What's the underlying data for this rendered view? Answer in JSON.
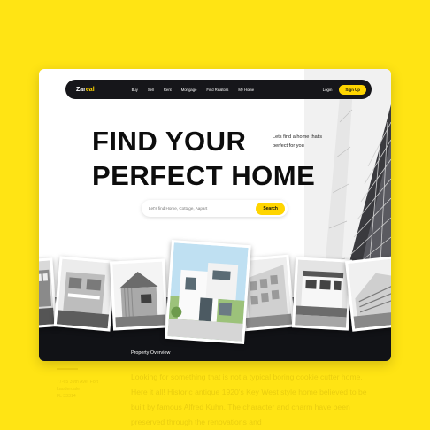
{
  "nav": {
    "logo_main": "Zar",
    "logo_accent": "eal",
    "menu": [
      "Buy",
      "Sell",
      "Rent",
      "Mortgage",
      "Find Realtors",
      "My Home"
    ],
    "login": "Login",
    "signup": "Sign Up"
  },
  "hero": {
    "title_line1": "FIND YOUR",
    "title_line2": "PERFECT HOME",
    "tagline": "Lets find a home that's perfect for you"
  },
  "search": {
    "placeholder": "Let's find Home, Cottage, Aapart",
    "button": "Search"
  },
  "section": {
    "overview_label": "Property Overview"
  },
  "reflection": {
    "address": [
      "77-65 39th Ave, Fort",
      "Lauderdale",
      "FL 33314"
    ],
    "paragraph": "Looking for something that is not a typical boring cookie cutter home. Here it all! Historic antique 1920's Key West style home believed to be built by famous Alfred Kuhn. The character and charm have been preserved through the renovations and"
  },
  "colors": {
    "accent": "#ffd500",
    "background": "#ffe414",
    "dark": "#16161a"
  }
}
